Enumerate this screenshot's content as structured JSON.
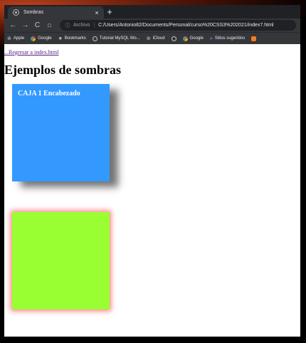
{
  "browser": {
    "tab_title": "Sombras",
    "tab_close": "×",
    "new_tab": "+",
    "nav": {
      "back": "←",
      "forward": "→",
      "reload": "C",
      "home": "⌂"
    },
    "omnibox": {
      "info_icon": "ⓘ",
      "scheme_label": "Archivo",
      "url": "C:/Users/Antonio82/Documents/Personal/curso%20CSS3%202021/index7.html"
    },
    "bookmarks": [
      {
        "label": "Apple",
        "icon": "apple-icon"
      },
      {
        "label": "Google",
        "icon": "google-icon"
      },
      {
        "label": "Bookmarks",
        "icon": "star-icon"
      },
      {
        "label": "Tutorial MySQL Wo...",
        "icon": "globe-icon"
      },
      {
        "label": "iCloud",
        "icon": "apple-icon"
      },
      {
        "label": "",
        "icon": "globe-icon"
      },
      {
        "label": "Google",
        "icon": "google-icon"
      },
      {
        "label": "Sitios sugeridos",
        "icon": "search-icon"
      },
      {
        "label": "",
        "icon": "bookmark-orange-icon"
      }
    ]
  },
  "page": {
    "back_link": "...Regresar a index.html",
    "title": "Ejemplos de sombras",
    "box1": {
      "heading": "CAJA 1 Encabezado",
      "color": "#3399ff"
    },
    "box2": {
      "color": "#99ff33",
      "shadow_color": "#ff5050"
    }
  }
}
